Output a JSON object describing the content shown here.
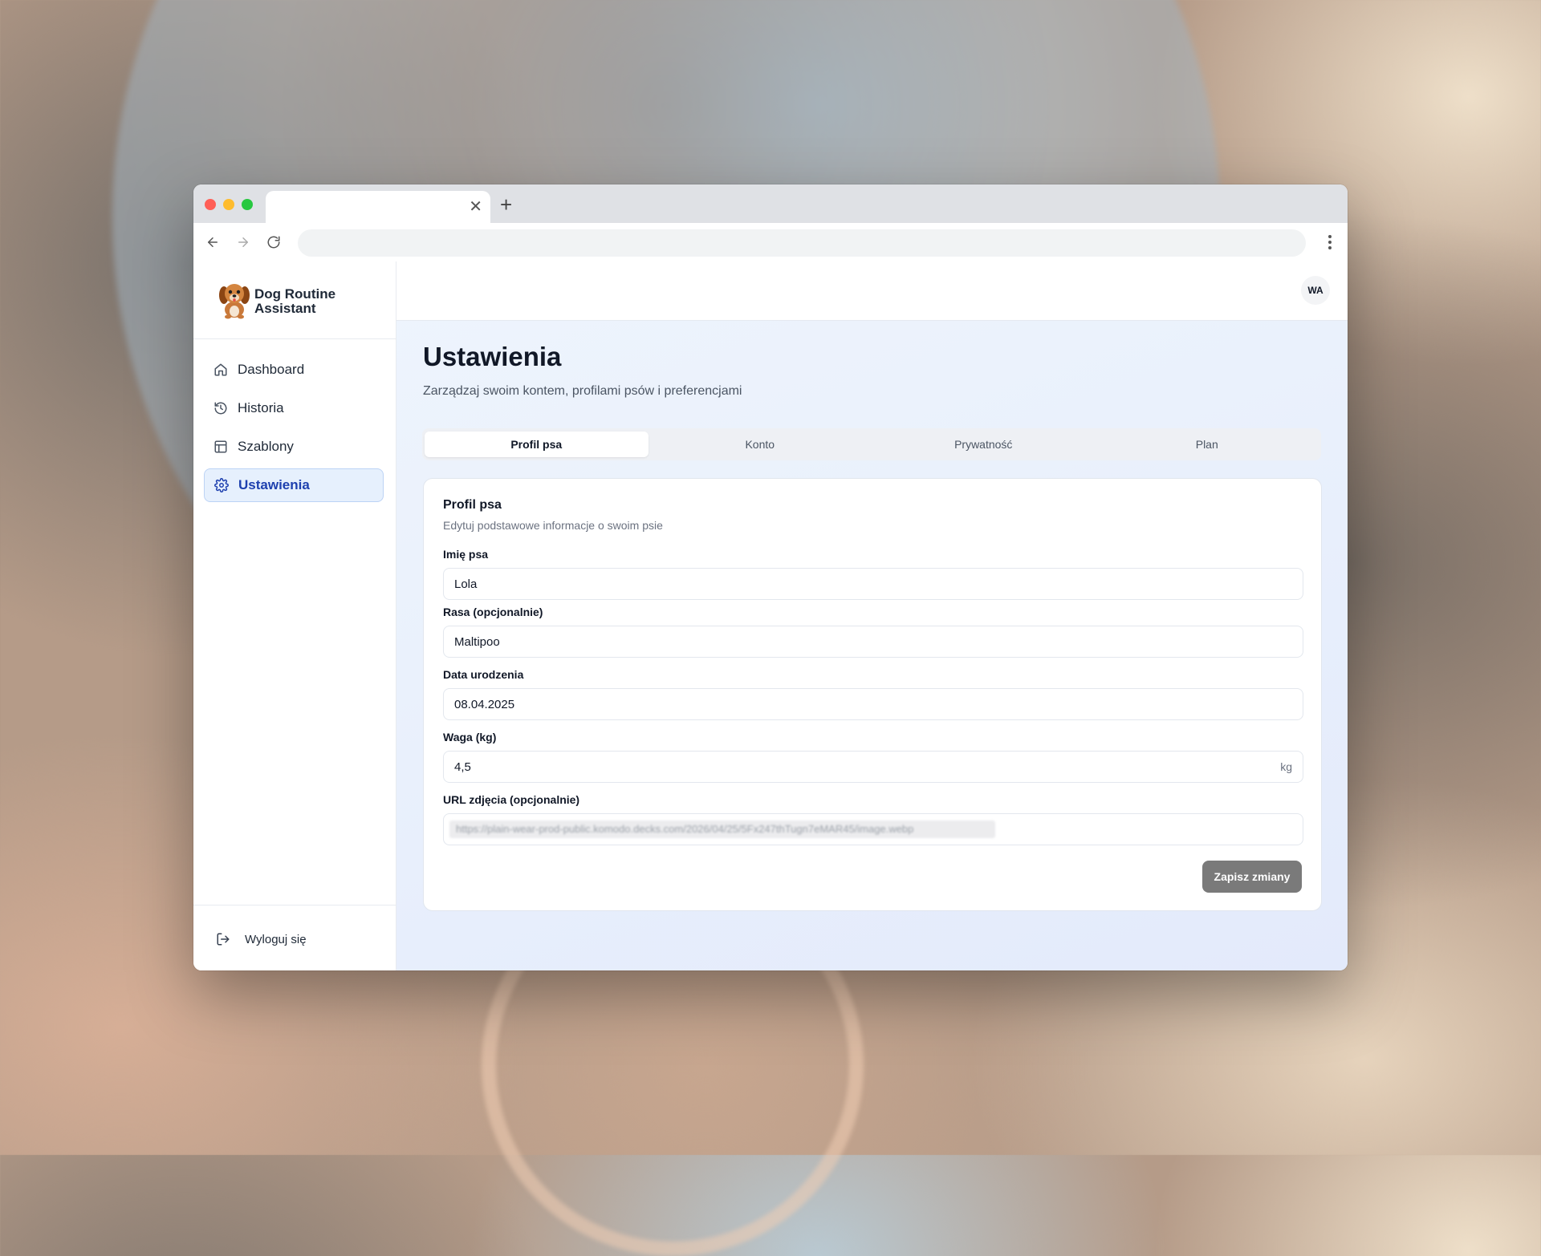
{
  "browser": {
    "tab_close": "✕",
    "new_tab": "+"
  },
  "app": {
    "brand_name": "Dog Routine Assistant",
    "logo_icon": "dog-mascot-icon"
  },
  "sidebar": {
    "items": [
      {
        "label": "Dashboard",
        "icon": "home-icon",
        "active": false
      },
      {
        "label": "Historia",
        "icon": "history-icon",
        "active": false
      },
      {
        "label": "Szablony",
        "icon": "layout-icon",
        "active": false
      },
      {
        "label": "Ustawienia",
        "icon": "gear-icon",
        "active": true
      }
    ],
    "logout_label": "Wyloguj się"
  },
  "header": {
    "avatar_initials": "WA"
  },
  "page": {
    "title": "Ustawienia",
    "subtitle": "Zarządzaj swoim kontem, profilami psów i preferencjami"
  },
  "tabs": [
    {
      "label": "Profil psa",
      "active": true
    },
    {
      "label": "Konto",
      "active": false
    },
    {
      "label": "Prywatność",
      "active": false
    },
    {
      "label": "Plan",
      "active": false
    }
  ],
  "card": {
    "title": "Profil psa",
    "subtitle": "Edytuj podstawowe informacje o swoim psie",
    "fields": {
      "name": {
        "label": "Imię psa",
        "value": "Lola"
      },
      "breed": {
        "label": "Rasa (opcjonalnie)",
        "value": "Maltipoo"
      },
      "birthdate": {
        "label": "Data urodzenia",
        "value": "08.04.2025"
      },
      "weight": {
        "label": "Waga (kg)",
        "value": "4,5",
        "unit": "kg"
      },
      "photo_url": {
        "label": "URL zdjęcia (opcjonalnie)",
        "value": "https://plain-wear-prod-public.komodo.decks.com/2026/04/25/5Fx247thTugn7eMAR45/image.webp"
      }
    },
    "save_label": "Zapisz zmiany"
  },
  "colors": {
    "accent": "#1e40af",
    "active_bg": "#e6f0fd",
    "save_button": "#7a7a7a"
  }
}
